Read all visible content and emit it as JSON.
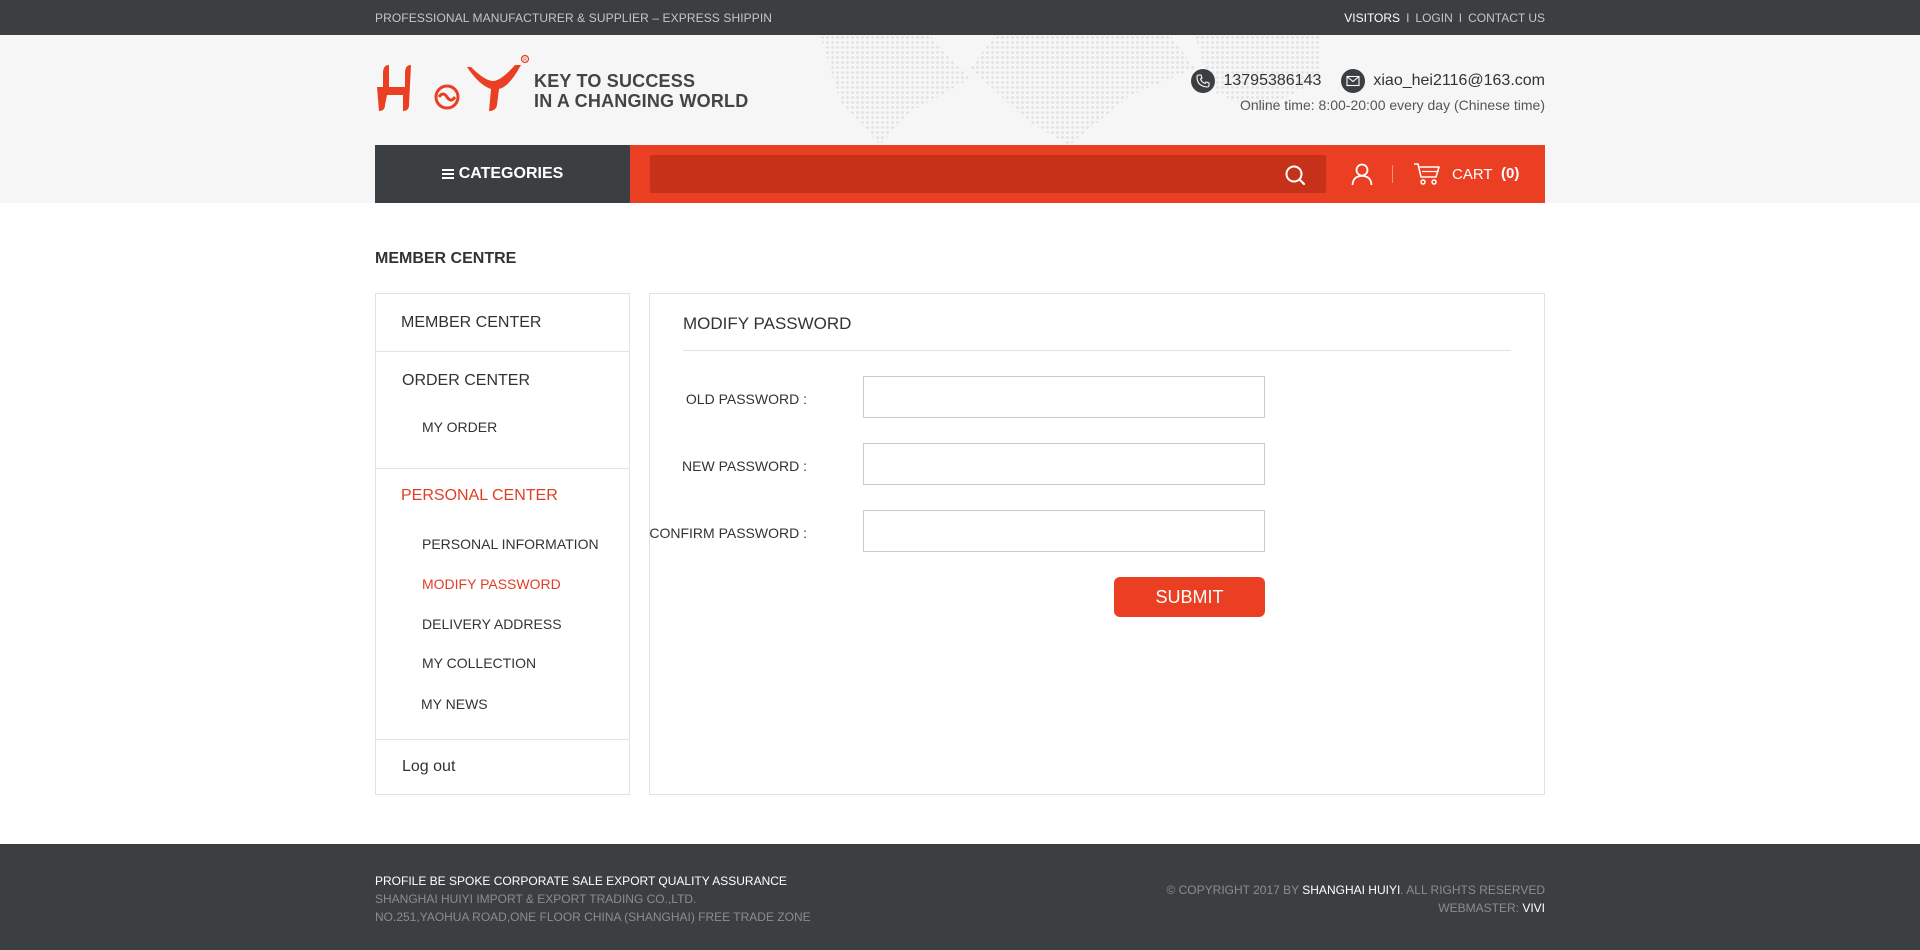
{
  "topbar": {
    "tagline": "PROFESSIONAL MANUFACTURER & SUPPLIER – EXPRESS SHIPPIN",
    "links": [
      "VISITORS",
      "LOGIN",
      "CONTACT US"
    ],
    "separator": "I"
  },
  "header": {
    "logo_text": "H·Y",
    "slogan_line1": "KEY TO SUCCESS",
    "slogan_line2": "IN A CHANGING WORLD",
    "phone": "13795386143",
    "email": "xiao_hei2116@163.com",
    "online_time": "Online time: 8:00-20:00 every day (Chinese time)",
    "icons": [
      "phone-icon",
      "mail-icon"
    ]
  },
  "nav": {
    "categories_label": "CATEGORIES",
    "search_placeholder": "",
    "cart_label": "CART",
    "cart_count": "(0)",
    "accent_color": "#ea3f22",
    "dark_color": "#3c3f42"
  },
  "page": {
    "title": "MEMBER CENTRE"
  },
  "sidebar": {
    "member_center": "MEMBER CENTER",
    "order_center": "ORDER CENTER",
    "my_order": "MY ORDER",
    "personal_center": "PERSONAL CENTER",
    "personal_items": [
      "PERSONAL INFORMATION",
      "MODIFY PASSWORD",
      "DELIVERY ADDRESS",
      "MY COLLECTION",
      "MY NEWS"
    ],
    "logout": "Log out"
  },
  "form": {
    "title": "MODIFY PASSWORD",
    "old_label": "OLD PASSWORD :",
    "new_label": "NEW PASSWORD :",
    "confirm_label": "CONFIRM PASSWORD :",
    "old_value": "",
    "new_value": "",
    "confirm_value": "",
    "submit_label": "SUBMIT"
  },
  "footer": {
    "line1": "PROFILE BE SPOKE CORPORATE SALE EXPORT QUALITY ASSURANCE",
    "line2": "SHANGHAI HUIYI IMPORT & EXPORT  TRADING CO.,LTD.",
    "line3": "NO.251,YAOHUA ROAD,ONE FLOOR  CHINA (SHANGHAI) FREE TRADE ZONE",
    "copyright_prefix": "© COPYRIGHT 2017 BY ",
    "company": "SHANGHAI HUIYI",
    "copyright_suffix": ". ALL RIGHTS RESERVED",
    "webmaster_label": "WEBMASTER: ",
    "webmaster_name": "VIVI"
  }
}
